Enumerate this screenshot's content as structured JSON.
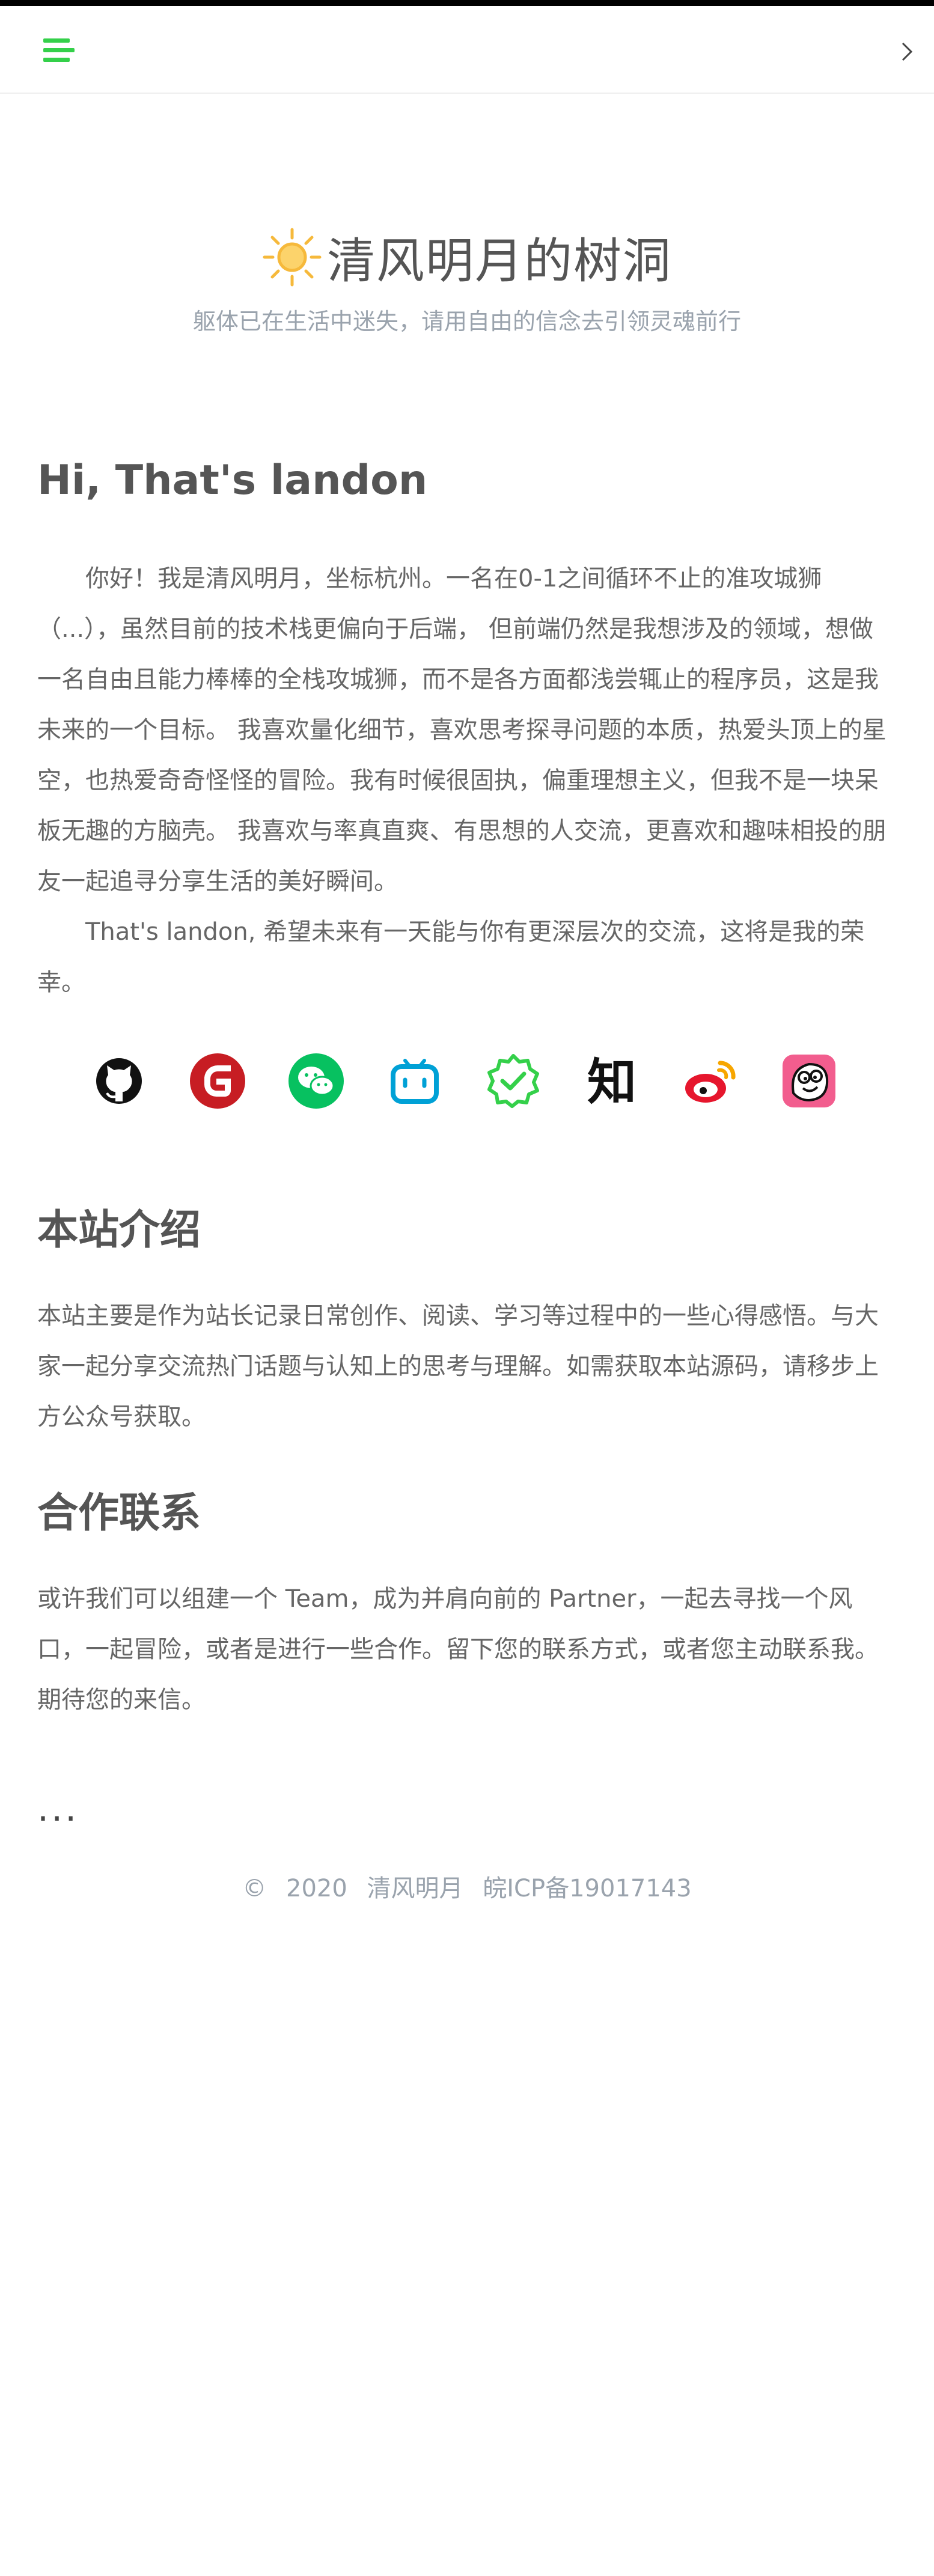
{
  "hero": {
    "title": "清风明月的树洞",
    "subtitle": "躯体已在生活中迷失，请用自由的信念去引领灵魂前行"
  },
  "intro": {
    "heading": "Hi, That's landon",
    "paragraph1": "你好！我是清风明月，坐标杭州。一名在0-1之间循环不止的准攻城狮（...），虽然目前的技术栈更偏向于后端， 但前端仍然是我想涉及的领域，想做一名自由且能力棒棒的全栈攻城狮，而不是各方面都浅尝辄止的程序员，这是我未来的一个目标。 我喜欢量化细节，喜欢思考探寻问题的本质，热爱头顶上的星空，也热爱奇奇怪怪的冒险。我有时候很固执，偏重理想主义，但我不是一块呆板无趣的方脑壳。 我喜欢与率真直爽、有思想的人交流，更喜欢和趣味相投的朋友一起追寻分享生活的美好瞬间。",
    "paragraph2": "That's landon, 希望未来有一天能与你有更深层次的交流，这将是我的荣幸。"
  },
  "socials": [
    {
      "icon": "github-icon"
    },
    {
      "icon": "gitee-icon"
    },
    {
      "icon": "wechat-icon"
    },
    {
      "icon": "bilibili-icon"
    },
    {
      "icon": "verified-badge-icon"
    },
    {
      "icon": "zhihu-icon",
      "glyph": "知"
    },
    {
      "icon": "weibo-icon"
    },
    {
      "icon": "avatar-face-icon"
    }
  ],
  "about": {
    "heading": "本站介绍",
    "text": "本站主要是作为站长记录日常创作、阅读、学习等过程中的一些心得感悟。与大家一起分享交流热门话题与认知上的思考与理解。如需获取本站源码，请移步上方公众号获取。"
  },
  "contact": {
    "heading": "合作联系",
    "text": "或许我们可以组建一个 Team，成为并肩向前的 Partner，一起去寻找一个风口，一起冒险，或者是进行一些合作。留下您的联系方式，或者您主动联系我。期待您的来信。"
  },
  "ellipsis": "...",
  "footer": {
    "copyright": "©",
    "year": "2020",
    "name": "清风明月",
    "icp": "皖ICP备19017143"
  },
  "colors": {
    "accent": "#34d04a",
    "sun": "#f6b93b",
    "text": "#555555",
    "muted": "#9aa3ad"
  }
}
